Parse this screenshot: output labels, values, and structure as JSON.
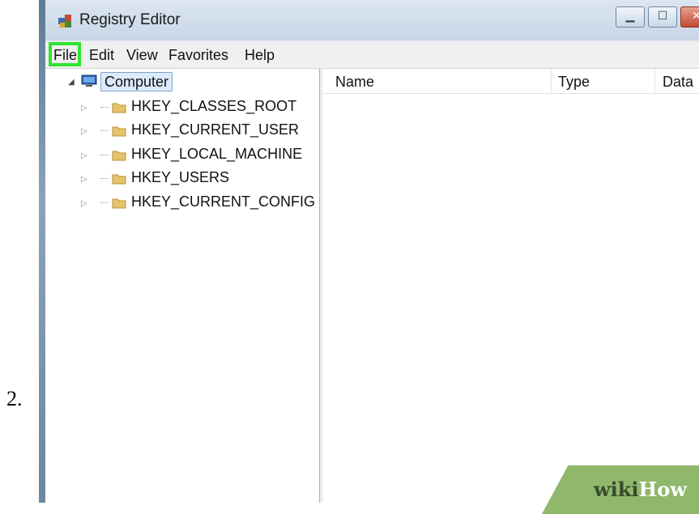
{
  "step": {
    "number": "2."
  },
  "window": {
    "title": "Registry Editor",
    "icon": "registry-editor-icon",
    "controls": [
      "minimize-icon",
      "maximize-icon",
      "close-icon"
    ]
  },
  "menubar": {
    "items": [
      "File",
      "Edit",
      "View",
      "Favorites",
      "Help"
    ],
    "highlighted": "File",
    "highlight_color": "#2ee62e"
  },
  "tree": {
    "root": {
      "label": "Computer",
      "icon": "computer-icon",
      "expanded": true
    },
    "children": [
      {
        "label": "HKEY_CLASSES_ROOT",
        "icon": "folder-icon"
      },
      {
        "label": "HKEY_CURRENT_USER",
        "icon": "folder-icon"
      },
      {
        "label": "HKEY_LOCAL_MACHINE",
        "icon": "folder-icon"
      },
      {
        "label": "HKEY_USERS",
        "icon": "folder-icon"
      },
      {
        "label": "HKEY_CURRENT_CONFIG",
        "icon": "folder-icon"
      }
    ]
  },
  "list": {
    "columns": [
      "Name",
      "Type",
      "Data"
    ]
  },
  "watermark": {
    "wiki": "wiki",
    "how": "How",
    "color": "#8fb86c"
  }
}
